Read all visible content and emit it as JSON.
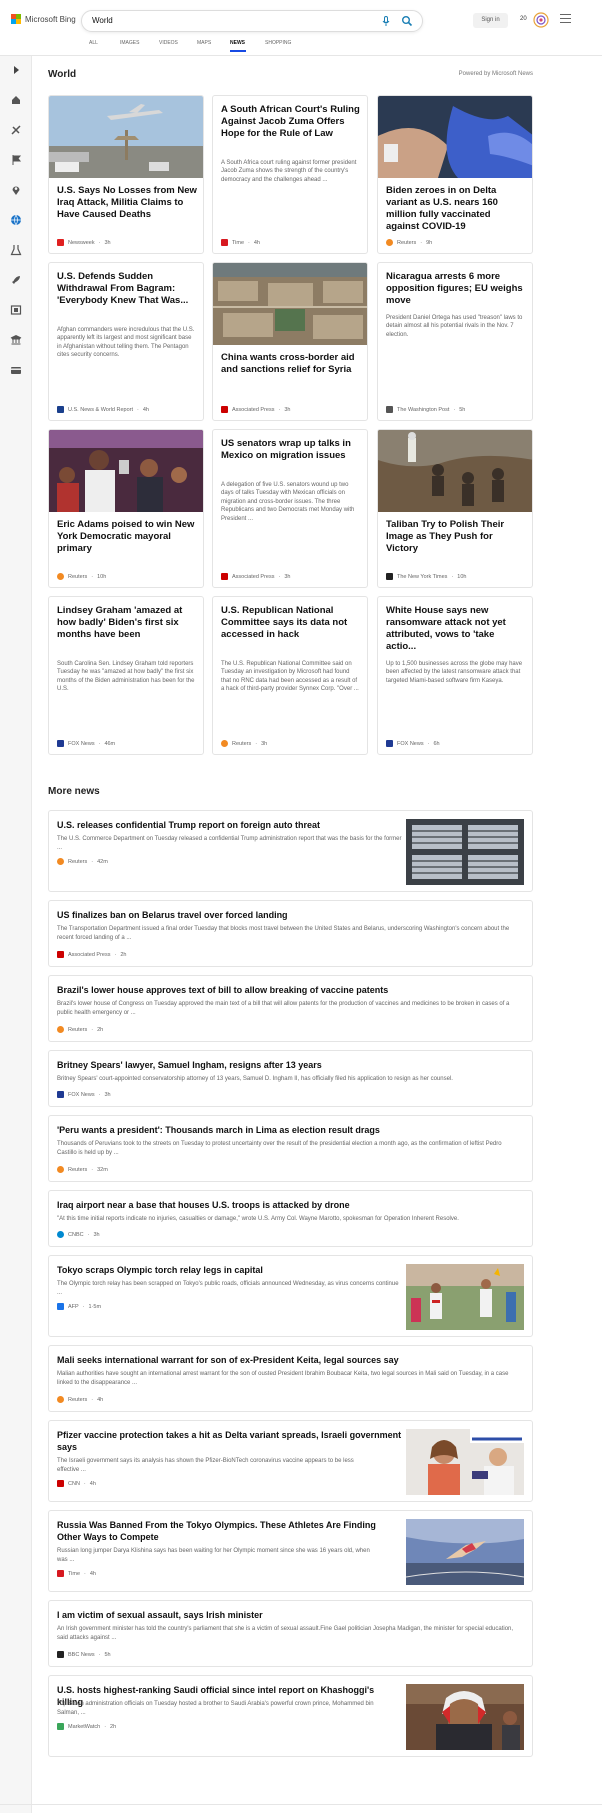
{
  "header": {
    "logo_text": "Microsoft Bing",
    "search_value": "World",
    "signin_label": "Sign in",
    "points": "20",
    "tabs": [
      {
        "label": "ALL",
        "active": false
      },
      {
        "label": "IMAGES",
        "active": false
      },
      {
        "label": "VIDEOS",
        "active": false
      },
      {
        "label": "MAPS",
        "active": false
      },
      {
        "label": "NEWS",
        "active": true
      },
      {
        "label": "SHOPPING",
        "active": false
      }
    ]
  },
  "rail": {
    "icons": [
      "chevron-right-icon",
      "home-icon",
      "sports-icon",
      "flag-icon",
      "location-pin-icon",
      "globe-icon",
      "science-icon",
      "rocket-icon",
      "film-icon",
      "bank-icon",
      "card-icon"
    ]
  },
  "section": {
    "title": "World",
    "powered_by": "Powered by Microsoft News"
  },
  "top_cards": [
    {
      "title": "U.S. Says No Losses from New Iraq Attack, Militia Claims to Have Caused Deaths",
      "snippet": "",
      "source": "Newsweek",
      "time": "3h",
      "src_color": "#e02020"
    },
    {
      "title": "A South African Court's Ruling Against Jacob Zuma Offers Hope for the Rule of Law",
      "snippet": "A South Africa court ruling against former president Jacob Zuma shows the strength of the country's democracy and the challenges ahead ...",
      "source": "Time",
      "time": "4h",
      "src_color": "#d71920"
    },
    {
      "title": "Biden zeroes in on Delta variant as U.S. nears 160 million fully vaccinated against COVID-19",
      "snippet": "",
      "source": "Reuters",
      "time": "9h",
      "src_color": "#f28a22"
    },
    {
      "title": "U.S. Defends Sudden Withdrawal From Bagram: 'Everybody Knew That Was...",
      "snippet": "Afghan commanders were incredulous that the U.S. apparently left its largest and most significant base in Afghanistan without telling them. The Pentagon cites security concerns.",
      "source": "U.S. News & World Report",
      "time": "4h",
      "src_color": "#1a3f8c"
    },
    {
      "title": "China wants cross-border aid and sanctions relief for Syria",
      "snippet": "",
      "source": "Associated Press",
      "time": "3h",
      "src_color": "#cc0000"
    },
    {
      "title": "Nicaragua arrests 6 more opposition figures; EU weighs move",
      "snippet": "President Daniel Ortega has used \"treason\" laws to detain almost all his potential rivals in the Nov. 7 election.",
      "source": "The Washington Post",
      "time": "5h",
      "src_color": "#555555"
    },
    {
      "title": "Eric Adams poised to win New York Democratic mayoral primary",
      "snippet": "",
      "source": "Reuters",
      "time": "10h",
      "src_color": "#f28a22"
    },
    {
      "title": "US senators wrap up talks in Mexico on migration issues",
      "snippet": "A delegation of five U.S. senators wound up two days of talks Tuesday with Mexican officials on migration and cross-border issues. The three Republicans and two Democrats met Monday with President ...",
      "source": "Associated Press",
      "time": "3h",
      "src_color": "#cc0000"
    },
    {
      "title": "Taliban Try to Polish Their Image as They Push for Victory",
      "snippet": "",
      "source": "The New York Times",
      "time": "10h",
      "src_color": "#222222"
    },
    {
      "title": "Lindsey Graham 'amazed at how badly' Biden's first six months have been",
      "snippet": "South Carolina Sen. Lindsey Graham told reporters Tuesday he was \"amazed at how badly\" the first six months of the Biden administration has been for the U.S.",
      "source": "FOX News",
      "time": "46m",
      "src_color": "#1f3a93"
    },
    {
      "title": "U.S. Republican National Committee says its data not accessed in hack",
      "snippet": "The U.S. Republican National Committee said on Tuesday an investigation by Microsoft had found that no RNC data had been accessed as a result of a hack of third-party provider Synnex Corp. \"Over ...",
      "source": "Reuters",
      "time": "3h",
      "src_color": "#f28a22"
    },
    {
      "title": "White House says new ransomware attack not yet attributed, vows to 'take actio...",
      "snippet": "Up to 1,500 businesses across the globe may have been affected by the latest ransomware attack that targeted Miami-based software firm Kaseya.",
      "source": "FOX News",
      "time": "6h",
      "src_color": "#1f3a93"
    }
  ],
  "more_news": {
    "title": "More news",
    "items": [
      {
        "title": "U.S. releases confidential Trump report on foreign auto threat",
        "snippet": "The U.S. Commerce Department on Tuesday released a confidential Trump administration report that was the basis for the former ...",
        "source": "Reuters",
        "time": "42m",
        "src_color": "#f28a22",
        "has_image": true
      },
      {
        "title": "US finalizes ban on Belarus travel over forced landing",
        "snippet": "The Transportation Department issued a final order Tuesday that blocks most travel between the United States and Belarus, underscoring Washington's concern about the recent forced landing of a ...",
        "source": "Associated Press",
        "time": "2h",
        "src_color": "#cc0000",
        "has_image": false
      },
      {
        "title": "Brazil's lower house approves text of bill to allow breaking of vaccine patents",
        "snippet": "Brazil's lower house of Congress on Tuesday approved the main text of a bill that will allow patents for the production of vaccines and medicines to be broken in cases of a public health emergency or ...",
        "source": "Reuters",
        "time": "2h",
        "src_color": "#f28a22",
        "has_image": false
      },
      {
        "title": "Britney Spears' lawyer, Samuel Ingham, resigns after 13 years",
        "snippet": "Britney Spears' court-appointed conservatorship attorney of 13 years, Samuel D. Ingham II, has officially filed his application to resign as her counsel.",
        "source": "FOX News",
        "time": "3h",
        "src_color": "#1f3a93",
        "has_image": false
      },
      {
        "title": "'Peru wants a president': Thousands march in Lima as election result drags",
        "snippet": "Thousands of Peruvians took to the streets on Tuesday to protest uncertainty over the result of the presidential election a month ago, as the confirmation of leftist Pedro Castillo is held up by ...",
        "source": "Reuters",
        "time": "32m",
        "src_color": "#f28a22",
        "has_image": false
      },
      {
        "title": "Iraq airport near a base that houses U.S. troops is attacked by drone",
        "snippet": "\"At this time initial reports indicate no injuries, casualties or damage,\" wrote U.S. Army Col. Wayne Marotto, spokesman for Operation Inherent Resolve.",
        "source": "CNBC",
        "time": "3h",
        "src_color": "#0089d0",
        "has_image": false
      },
      {
        "title": "Tokyo scraps Olympic torch relay legs in capital",
        "snippet": "The Olympic torch relay has been scrapped on Tokyo's public roads, officials announced Wednesday, as virus concerns continue ...",
        "source": "AFP",
        "time": "1·5m",
        "src_color": "#1a73e8",
        "has_image": true
      },
      {
        "title": "Mali seeks international warrant for son of ex-President Keita, legal sources say",
        "snippet": "Malian authorities have sought an international arrest warrant for the son of ousted President Ibrahim Boubacar Keita, two legal sources in Mali said on Tuesday, in a case linked to the disappearance ...",
        "source": "Reuters",
        "time": "4h",
        "src_color": "#f28a22",
        "has_image": false
      },
      {
        "title": "Pfizer vaccine protection takes a hit as Delta variant spreads, Israeli government says",
        "snippet": "The Israeli government says its analysis has shown the Pfizer-BioNTech coronavirus vaccine appears to be less effective ...",
        "source": "CNN",
        "time": "4h",
        "src_color": "#cc0000",
        "has_image": true
      },
      {
        "title": "Russia Was Banned From the Tokyo Olympics. These Athletes Are Finding Other Ways to Compete",
        "snippet": "Russian long jumper Darya Klishina says has been waiting for her Olympic moment since she was 16 years old, when was ...",
        "source": "Time",
        "time": "4h",
        "src_color": "#d71920",
        "has_image": true
      },
      {
        "title": "I am victim of sexual assault, says Irish minister",
        "snippet": "An Irish government minister has told the country's parliament that she is a victim of sexual assault.Fine Gael politician Josepha Madigan, the minister for special education, said attacks against ...",
        "source": "BBC News",
        "time": "5h",
        "src_color": "#222222",
        "has_image": false
      },
      {
        "title": "U.S. hosts highest-ranking Saudi official since intel report on Khashoggi's killing",
        "snippet": "Top Biden administration officials on Tuesday hosted a brother to Saudi Arabia's powerful crown prince, Mohammed bin Salman, ...",
        "source": "MarketWatch",
        "time": "2h",
        "src_color": "#3aa65a",
        "has_image": true
      }
    ]
  },
  "colors": {
    "accent": "#174ae4",
    "search_icon": "#1a7fb5"
  }
}
